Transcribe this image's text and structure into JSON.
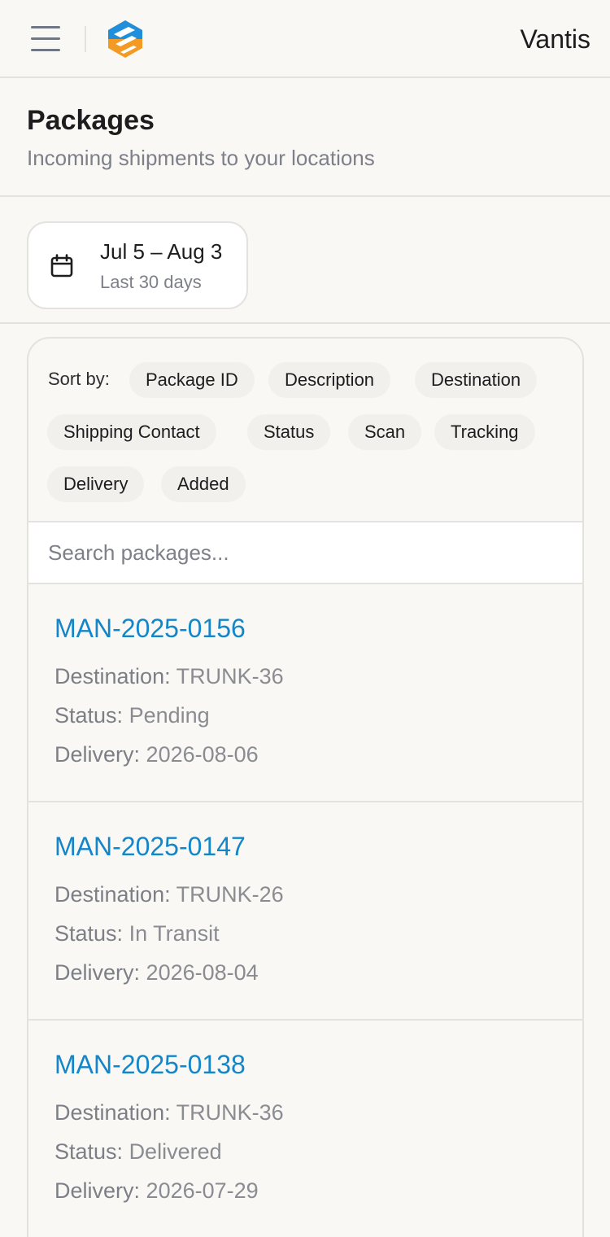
{
  "header": {
    "brand": "Vantis",
    "colors": {
      "logo_blue": "#1f8fdb",
      "logo_orange": "#f39a25"
    }
  },
  "page": {
    "title": "Packages",
    "subtitle": "Incoming shipments to your locations"
  },
  "date_filter": {
    "range": "Jul 5 – Aug 3",
    "label": "Last 30 days"
  },
  "sort": {
    "label": "Sort by:",
    "options": [
      "Package ID",
      "Description",
      "Destination",
      "Shipping Contact",
      "Status",
      "Scan",
      "Tracking",
      "Delivery",
      "Added"
    ]
  },
  "search": {
    "placeholder": "Search packages..."
  },
  "fields": {
    "destination": "Destination:",
    "status": "Status:",
    "delivery": "Delivery:"
  },
  "packages": [
    {
      "id": "MAN-2025-0156",
      "destination": "TRUNK-36",
      "status": "Pending",
      "delivery": "2026-08-06"
    },
    {
      "id": "MAN-2025-0147",
      "destination": "TRUNK-26",
      "status": "In Transit",
      "delivery": "2026-08-04"
    },
    {
      "id": "MAN-2025-0138",
      "destination": "TRUNK-36",
      "status": "Delivered",
      "delivery": "2026-07-29"
    }
  ],
  "icons": {
    "menu": "hamburger-menu-icon",
    "logo": "vantis-logo",
    "calendar": "calendar-icon"
  }
}
